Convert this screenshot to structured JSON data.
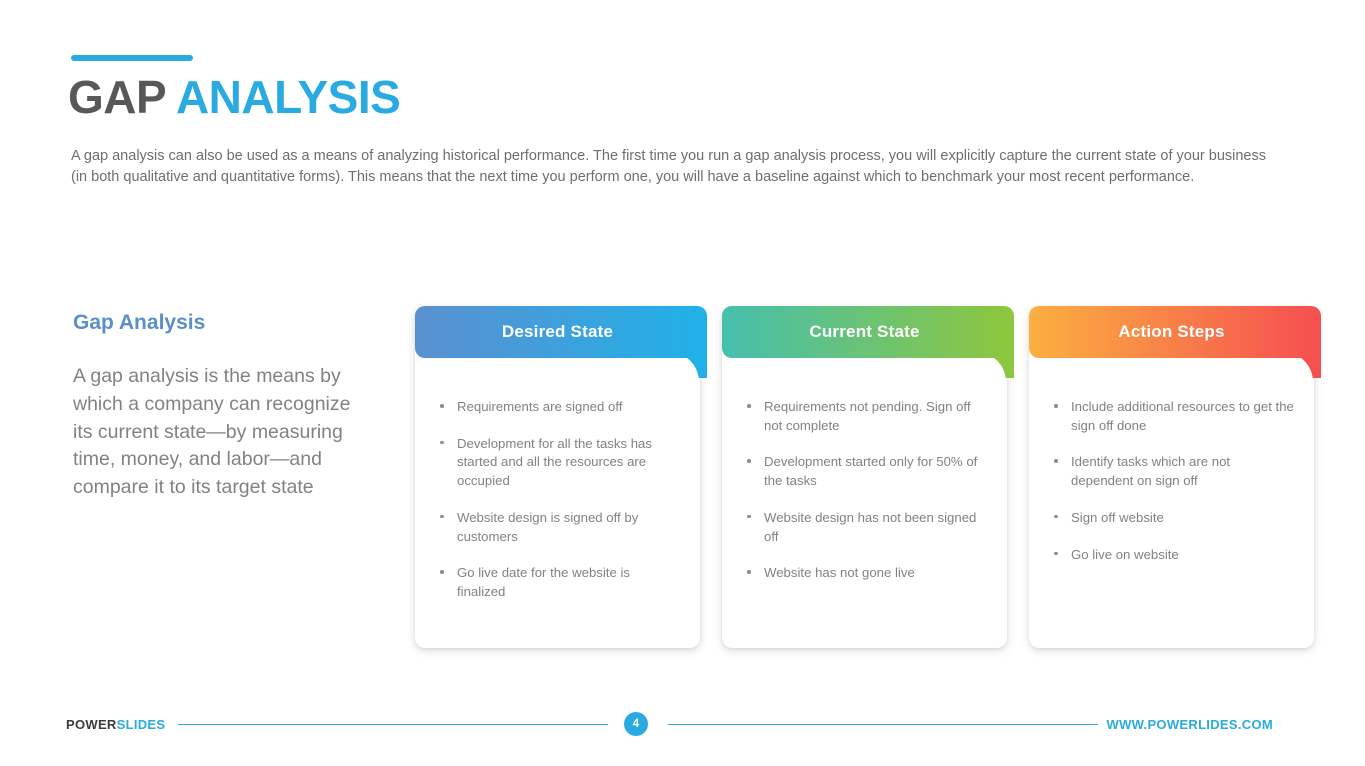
{
  "title": {
    "primary": "GAP",
    "accent": "ANALYSIS"
  },
  "intro": "A gap analysis can also be used as a means of analyzing historical performance. The first time you run a gap analysis process, you will explicitly capture the current state of your business (in both qualitative and quantitative forms). This means that the next time you perform one, you will have a baseline against which to benchmark your most recent performance.",
  "left_column": {
    "heading": "Gap Analysis",
    "body": "A gap analysis is the means by which a company can recognize its current state—by measuring time, money, and labor—and compare it to its target state"
  },
  "cards": [
    {
      "title": "Desired State",
      "gradient_start": "#5b90d0",
      "gradient_end": "#21b0e8",
      "bullets": [
        "Requirements are signed off",
        "Development for all the tasks has started and all the resources are occupied",
        "Website design is signed off by customers",
        "Go live date for the website is finalized"
      ]
    },
    {
      "title": "Current State",
      "gradient_start": "#46bfad",
      "gradient_end": "#8dc63f",
      "bullets": [
        "Requirements not pending. Sign off not complete",
        "Development started only for 50% of the tasks",
        "Website design has not been signed off",
        "Website has not gone live"
      ]
    },
    {
      "title": "Action Steps",
      "gradient_start": "#fbb040",
      "gradient_end": "#f55050",
      "bullets": [
        "Include additional resources to get the sign off done",
        "Identify tasks which are not dependent on sign off",
        "Sign off website",
        "Go live on website"
      ]
    }
  ],
  "footer": {
    "logo_primary": "POWER",
    "logo_accent": "SLIDES",
    "page_number": "4",
    "url": "WWW.POWERLIDES.COM"
  },
  "colors": {
    "accent": "#29abe2",
    "title_dark": "#58585b",
    "body_text": "#808285",
    "heading_blue": "#5b8fc9"
  }
}
